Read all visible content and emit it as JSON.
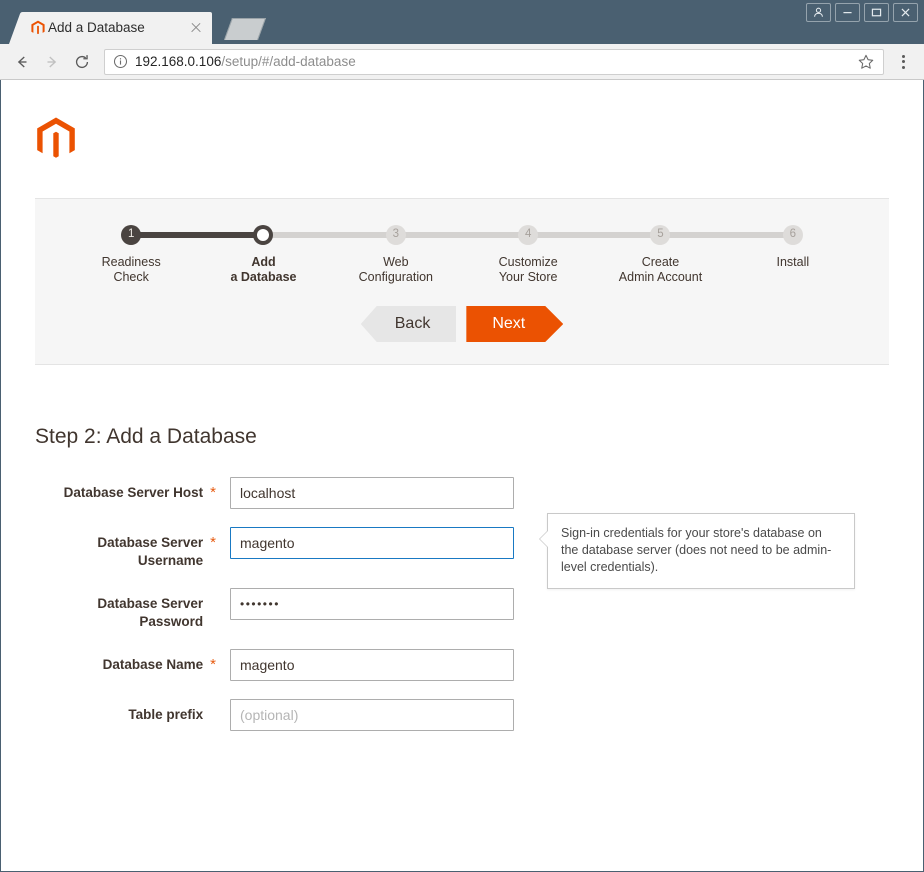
{
  "browser": {
    "tab": {
      "title": "Add a Database",
      "favicon": "magento-logo-icon",
      "close_icon": "close-icon"
    },
    "new_tab_icon": "new-tab-icon",
    "window_controls": [
      {
        "name": "profile-icon",
        "glyph": "person"
      },
      {
        "name": "minimize-icon",
        "glyph": "minimize"
      },
      {
        "name": "maximize-icon",
        "glyph": "maximize"
      },
      {
        "name": "close-icon",
        "glyph": "close"
      }
    ],
    "nav": {
      "back_icon": "back-arrow-icon",
      "forward_icon": "forward-arrow-icon",
      "reload_icon": "reload-icon"
    },
    "omnibox": {
      "info_icon": "info-icon",
      "url_host": "192.168.0.106",
      "url_path": "/setup/#/add-database",
      "bookmark_icon": "star-icon"
    },
    "menu_icon": "kebab-menu-icon"
  },
  "page": {
    "logo": "magento-logo",
    "stepper": {
      "steps": [
        {
          "number": "1",
          "label": "Readiness\nCheck",
          "state": "done"
        },
        {
          "number": "2",
          "label": "Add\na Database",
          "state": "current"
        },
        {
          "number": "3",
          "label": "Web\nConfiguration",
          "state": "pending"
        },
        {
          "number": "4",
          "label": "Customize\nYour Store",
          "state": "pending"
        },
        {
          "number": "5",
          "label": "Create\nAdmin Account",
          "state": "pending"
        },
        {
          "number": "6",
          "label": "Install",
          "state": "pending"
        }
      ],
      "back_label": "Back",
      "next_label": "Next"
    },
    "form": {
      "title": "Step 2: Add a Database",
      "required_marker": "*",
      "fields": [
        {
          "label": "Database Server Host",
          "required": true,
          "value": "localhost",
          "placeholder": "",
          "focused": false,
          "type": "text"
        },
        {
          "label": "Database Server Username",
          "required": true,
          "value": "magento",
          "placeholder": "",
          "focused": true,
          "type": "text"
        },
        {
          "label": "Database Server Password",
          "required": false,
          "value": "•••••••",
          "placeholder": "",
          "focused": false,
          "type": "password"
        },
        {
          "label": "Database Name",
          "required": true,
          "value": "magento",
          "placeholder": "",
          "focused": false,
          "type": "text"
        },
        {
          "label": "Table prefix",
          "required": false,
          "value": "",
          "placeholder": "(optional)",
          "focused": false,
          "type": "text"
        }
      ],
      "tooltip": "Sign-in credentials for your store's database on the database server (does not need to be admin-level credentials)."
    }
  },
  "colors": {
    "magento_orange": "#eb5202",
    "chrome_frame": "#4a6071",
    "focus_blue": "#1979c3",
    "step_dark": "#4a4441",
    "step_gray": "#d4d2d0"
  }
}
